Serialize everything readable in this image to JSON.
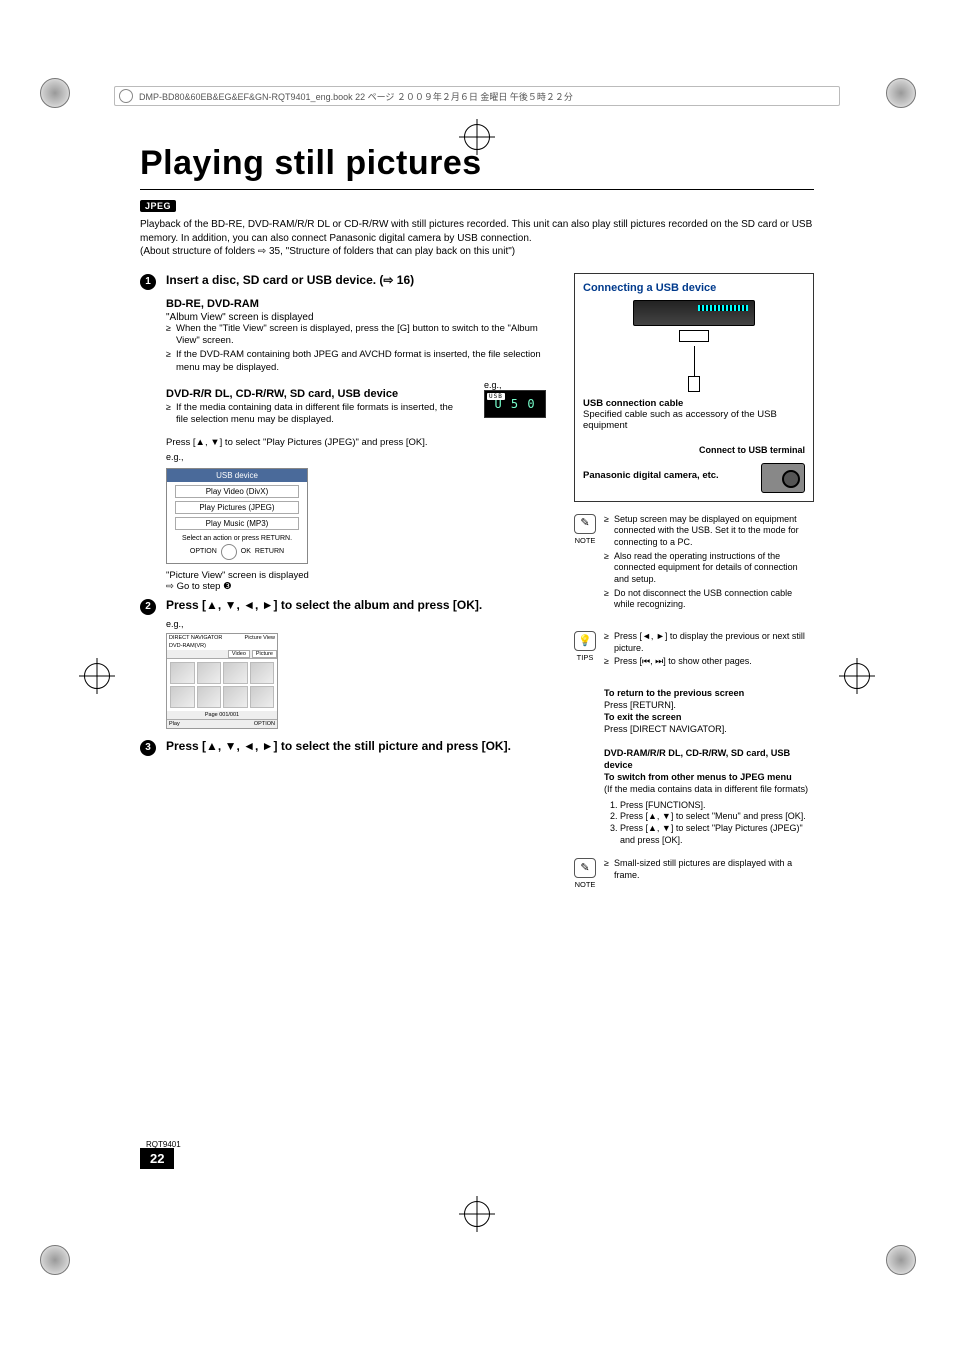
{
  "header_strip": "DMP-BD80&60EB&EG&EF&GN-RQT9401_eng.book  22 ページ  ２００９年２月６日  金曜日  午後５時２２分",
  "title": "Playing still pictures",
  "jpeg_badge": "JPEG",
  "intro_line1": "Playback of the BD-RE, DVD-RAM/R/R DL or CD-R/RW with still pictures recorded. This unit can also play still pictures recorded on the SD card or USB memory. In addition, you can also connect Panasonic digital camera by USB connection.",
  "intro_line2": "(About structure of folders ⇨ 35, \"Structure of folders that can play back on this unit\")",
  "step1": {
    "title": "Insert a disc, SD card or USB device. (⇨ 16)",
    "bdre_head": "BD-RE, DVD-RAM",
    "bdre_line": "\"Album View\" screen is displayed",
    "bdre_bullets": [
      "When the \"Title View\" screen is displayed, press the [G] button to switch to the \"Album View\" screen.",
      "If the DVD-RAM containing both JPEG and AVCHD format is inserted, the file selection menu may be displayed."
    ],
    "dvd_head": "DVD-R/R DL, CD-R/RW, SD card, USB device",
    "dvd_bullets": [
      "If the media containing data in different file formats is inserted, the file selection menu may be displayed."
    ],
    "dvd_press": "Press [▲, ▼] to select \"Play Pictures (JPEG)\" and press [OK].",
    "eg_label_1": "e.g.,",
    "eg_label_2": "e.g.,",
    "usb_menu": {
      "header": "USB device",
      "opts": [
        "Play Video (DivX)",
        "Play Pictures (JPEG)",
        "Play Music (MP3)"
      ],
      "foot": "Select an action or press RETURN.",
      "nav_left": "OPTION",
      "nav_ok": "OK",
      "nav_right": "RETURN"
    },
    "lcd": "U 5 0",
    "lcd_usb": "USB",
    "picture_view_line": "\"Picture View\" screen is displayed",
    "goto": "⇨ Go to step ❸"
  },
  "step2": {
    "title": "Press [▲, ▼, ◄, ►] to select the album and press [OK].",
    "eg_label": "e.g.,",
    "dn": {
      "top_left": "DIRECT NAVIGATOR",
      "top_right": "Picture View",
      "sub_left": "DVD-RAM(VR)",
      "tab_left": "Video",
      "tab_right": "Picture",
      "page": "Page 001/001",
      "foot_left": "Play",
      "foot_right": "OPTION"
    }
  },
  "step3": {
    "title": "Press [▲, ▼, ◄, ►] to select the still picture and press [OK]."
  },
  "right": {
    "box_title": "Connecting a USB device",
    "cable_label": "USB connection cable",
    "cable_desc": "Specified cable such as accessory of the USB equipment",
    "terminal_label": "Connect to USB terminal",
    "camera_label": "Panasonic digital camera, etc.",
    "note1_label": "NOTE",
    "note1_bullets": [
      "Setup screen may be displayed on equipment connected with the USB. Set it to the mode for connecting to a PC.",
      "Also read the operating instructions of the connected equipment for details of connection and setup.",
      "Do not disconnect the USB connection cable while recognizing."
    ],
    "tips_label": "TIPS",
    "tips_bullets": [
      "Press [◄, ►] to display the previous or next still picture.",
      "Press [⏮, ⏭] to show other pages."
    ],
    "return_head": "To return to the previous screen",
    "return_body": "Press [RETURN].",
    "exit_head": "To exit the screen",
    "exit_body": "Press [DIRECT NAVIGATOR].",
    "switch_head1": "DVD-RAM/R/R DL, CD-R/RW, SD card, USB device",
    "switch_head2": "To switch from other menus to JPEG menu",
    "switch_body": "(If the media contains data in different file formats)",
    "switch_steps": [
      "Press [FUNCTIONS].",
      "Press [▲, ▼] to select \"Menu\" and press [OK].",
      "Press [▲, ▼] to select \"Play Pictures (JPEG)\" and press [OK]."
    ],
    "note2_label": "NOTE",
    "note2_bullets": [
      "Small-sized still pictures are displayed with a frame."
    ]
  },
  "rqt": "RQT9401",
  "page_num": "22"
}
